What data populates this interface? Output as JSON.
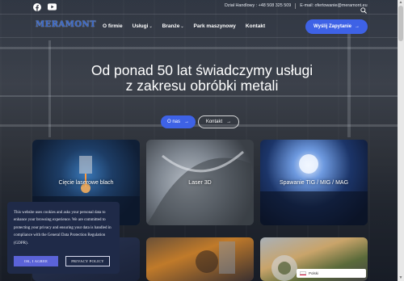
{
  "topbar": {
    "social": [
      "facebook-icon",
      "youtube-icon"
    ],
    "phone": "Dział Handlowy : +48 508 325 509",
    "email": "E-mail: ofertowanie@meramont.eu"
  },
  "nav": {
    "logo": "MERAMONT",
    "logo_sub": "",
    "items": [
      {
        "label": "O firmie",
        "dropdown": false
      },
      {
        "label": "Usługi",
        "dropdown": true
      },
      {
        "label": "Branże",
        "dropdown": true
      },
      {
        "label": "Park maszynowy",
        "dropdown": false
      },
      {
        "label": "Kontakt",
        "dropdown": false
      }
    ],
    "cta_label": "Wyślij Zapytanie"
  },
  "hero": {
    "headline": "Od ponad 50 lat świadczymy usługi z zakresu obróbki metali",
    "btn_primary": "O nas",
    "btn_secondary": "Kontakt"
  },
  "cards": [
    {
      "label": "Cięcie laserowe blach"
    },
    {
      "label": "Laser 3D"
    },
    {
      "label": "Spawanie TIG / MIG / MAG"
    },
    {
      "label": ""
    },
    {
      "label": ""
    },
    {
      "label": ""
    }
  ],
  "cookie": {
    "text": "This website uses cookies and asks your personal data to enhance your browsing experience. We are committed to protecting your privacy and ensuring your data is handled in compliance with the General Data Protection Regulation (GDPR).",
    "agree": "OK, I AGREE",
    "policy": "PRIVACY POLICY"
  },
  "lang": {
    "label": "Polski"
  },
  "colors": {
    "accent": "#3e62e6",
    "cookie_bg": "#1f2a48"
  }
}
